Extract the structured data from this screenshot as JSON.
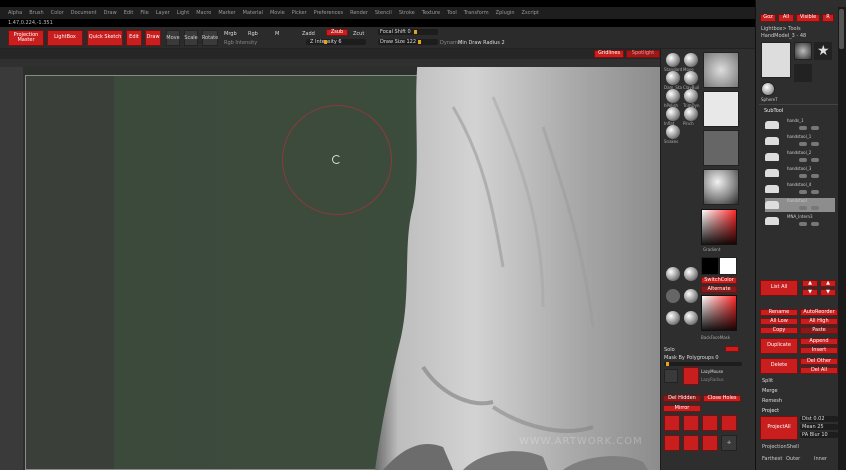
{
  "menubar": [
    "Alpha",
    "Brush",
    "Color",
    "Document",
    "Draw",
    "Edit",
    "File",
    "Layer",
    "Light",
    "Macro",
    "Marker",
    "Material",
    "Movie",
    "Picker",
    "Preferences",
    "Render",
    "Stencil",
    "Stroke",
    "Texture",
    "Tool",
    "Transform",
    "Zplugin",
    "Zscript"
  ],
  "info_line": "1.47,0.224,-1.351",
  "shelf": {
    "projection_master": "Projection Master",
    "lightbox": "LightBox",
    "quick_sketch": "Quick Sketch",
    "edit": "Edit",
    "draw": "Draw",
    "move": "Move",
    "scale": "Scale",
    "rotate": "Rotate",
    "mrgb": "Mrgb",
    "rgb": "Rgb",
    "m": "M",
    "zadd": "Zadd",
    "zsub": "Zsub",
    "zcut": "Zcut",
    "zsub_value": "Zsub",
    "rgb_intensity": "Rgb Intensity",
    "z_intensity": "Z Intensity 6",
    "focal_shift": "Focal Shift 0",
    "draw_size": "Draw Size 122",
    "dynamic": "Dynamic",
    "min_draw_radius": "Min Draw Radius 2"
  },
  "subshelf": {
    "gridlines": "Gridlines",
    "spotlight": "Spotlight"
  },
  "watermark": "WWW.ARTWORK.COM",
  "tray": {
    "brushes": [
      "Standard",
      "Move",
      "Dam_Sta",
      "ClayBuil",
      "hPolish",
      "TrimDyn",
      "Inflat",
      "Pinch",
      "Snakes"
    ],
    "gradient": "Gradient",
    "switch_color": "SwitchColor",
    "alternate": "Alternate",
    "backface": "BackFaceMask",
    "polish_by_features": "Polish By Features",
    "solo_mode": "Solo",
    "group_by_polygroups": "Mask By Polygroups 0",
    "lazy_mouse": "LazyMouse",
    "lazy_radius": "LazyRadius",
    "del_hidden": "Del Hidden",
    "close_holes": "Close Holes",
    "mirror": "Mirror"
  },
  "right_panel": {
    "tabs": [
      "Goz",
      "All",
      "Visible",
      "R"
    ],
    "lightbox_tools": "Lightbox> Tools",
    "hand_tool": "HandModel_3 - 48",
    "tools": [
      "SphereT",
      "Cylinder3D",
      "PolyMesh3D",
      "Simple",
      "Sphere3D"
    ],
    "subtool_header": "SubTool",
    "subtools": [
      "hands_1",
      "handstool_1",
      "handstool_2",
      "handstool_3",
      "handstool_4",
      "handstool",
      "MNA_Intern3"
    ],
    "list_all": "List All",
    "rename": "Rename",
    "autoreorder": "AutoReorder",
    "all_low": "All Low",
    "all_high": "All High",
    "copy": "Copy",
    "paste": "Paste",
    "duplicate": "Duplicate",
    "append": "Append",
    "insert": "Insert",
    "delete": "Delete",
    "del_other": "Del Other",
    "del_all": "Del All",
    "split": "Split",
    "merge": "Merge",
    "remesh": "Remesh",
    "project": "Project",
    "project_all": "ProjectAll",
    "dist": "Dist 0.02",
    "mean": "Mean 25",
    "pa_blur": "PA Blur 10",
    "projection_shell": "ProjectionShell",
    "farthest": "Farthest",
    "outer": "Outer",
    "inner": "Inner"
  },
  "colors": {
    "accent_red": "#c81e1e",
    "ui_dark": "#2e2e2e",
    "slider_orange": "#e6a21b"
  }
}
